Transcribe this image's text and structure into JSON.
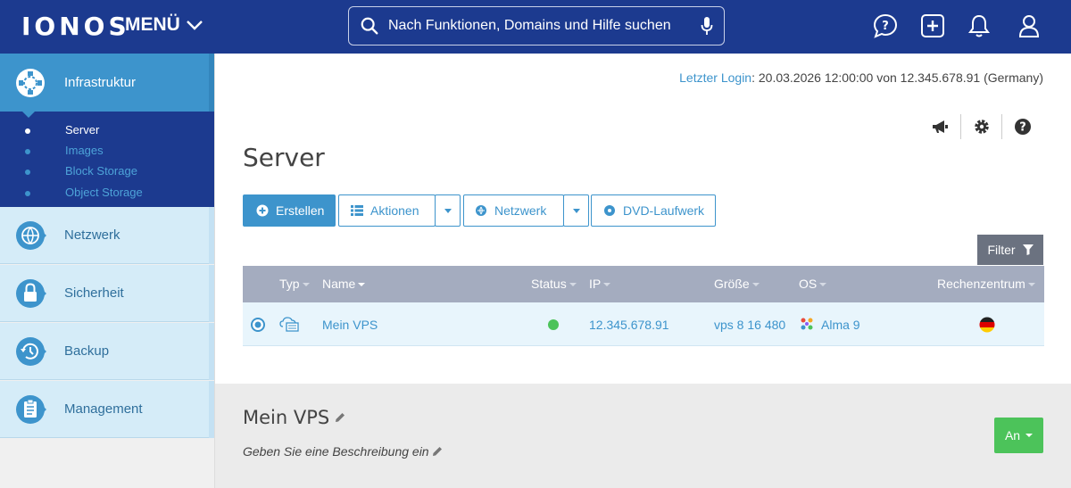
{
  "header": {
    "logo": "IONOS",
    "menu_label": "MENÜ",
    "search_placeholder": "Nach Funktionen, Domains und Hilfe suchen",
    "icons": [
      "help-chat-icon",
      "plus-square-icon",
      "bell-icon",
      "user-icon"
    ]
  },
  "sidebar": {
    "active": {
      "label": "Infrastruktur",
      "icon": "infrastructure-icon"
    },
    "submenu": [
      {
        "label": "Server",
        "active": true
      },
      {
        "label": "Images",
        "active": false
      },
      {
        "label": "Block Storage",
        "active": false
      },
      {
        "label": "Object Storage",
        "active": false
      }
    ],
    "items": [
      {
        "label": "Netzwerk",
        "icon": "network-globe-icon"
      },
      {
        "label": "Sicherheit",
        "icon": "lock-icon"
      },
      {
        "label": "Backup",
        "icon": "backup-clock-icon"
      },
      {
        "label": "Management",
        "icon": "clipboard-icon"
      }
    ]
  },
  "main": {
    "last_login_link": "Letzter Login",
    "last_login_text": ": 20.03.2026 12:00:00 von 12.345.678.91 (Germany)",
    "tools": [
      "megaphone-icon",
      "gear-icon",
      "help-circle-icon"
    ],
    "title": "Server",
    "buttons": {
      "create": "Erstellen",
      "actions": "Aktionen",
      "network": "Netzwerk",
      "dvd": "DVD-Laufwerk"
    },
    "filter_label": "Filter",
    "table": {
      "columns": [
        "Typ",
        "Name",
        "Status",
        "IP",
        "Größe",
        "OS",
        "Rechenzentrum"
      ],
      "rows": [
        {
          "name": "Mein VPS",
          "status": "running",
          "ip": "12.345.678.91",
          "size": "vps 8 16 480",
          "os": "Alma 9",
          "datacenter": "Germany"
        }
      ]
    }
  },
  "detail": {
    "title": "Mein VPS",
    "description_placeholder": "Geben Sie eine Beschreibung ein",
    "power_label": "An"
  },
  "colors": {
    "brand": "#1c3a8f",
    "accent": "#3d94cc",
    "status_ok": "#4cc35a"
  }
}
